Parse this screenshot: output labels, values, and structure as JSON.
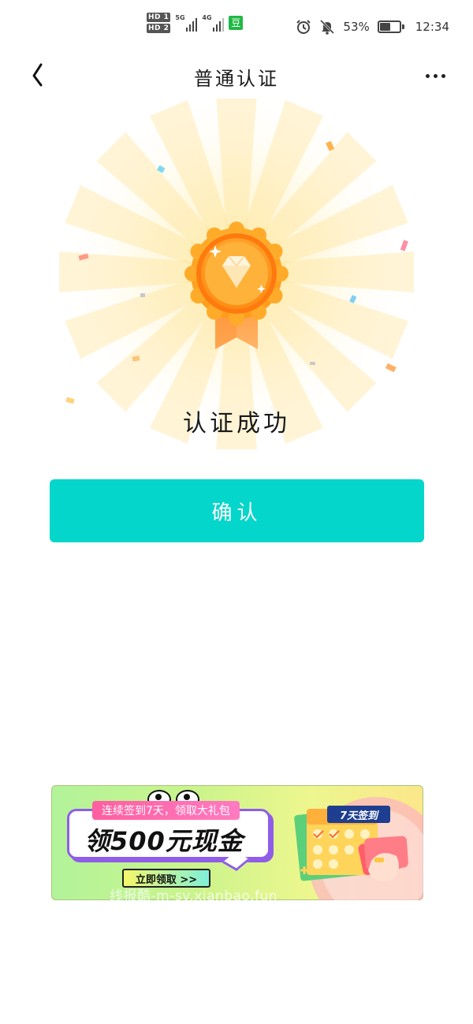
{
  "status_bar": {
    "hd_badges": [
      "HD 1",
      "HD 2"
    ],
    "network_1": "5G",
    "network_2": "4G",
    "app_badge": "豆",
    "battery_percent": "53%",
    "battery_level": 0.53,
    "time": "12:34",
    "icons": [
      "alarm-icon",
      "mute-icon",
      "battery-icon",
      "signal-icon"
    ]
  },
  "nav": {
    "title": "普通认证",
    "back_icon": "chevron-left-icon",
    "more_icon": "more-dots-icon"
  },
  "result": {
    "message": "认证成功",
    "icon": "medal-icon"
  },
  "actions": {
    "confirm_label": "确认"
  },
  "ad": {
    "subtitle": "连续签到7天，领取大礼包",
    "title": "领500元现金",
    "cta": "立即领取 >>",
    "badge": "7天签到",
    "watermark": "线报酷-m-sv.xianbao.fun"
  },
  "colors": {
    "primary": "#04d6cc",
    "medal_orange": "#ff9d1f",
    "medal_gold": "#ffc533",
    "ad_pink": "#ff5fa0",
    "ad_purple": "#8f5de8",
    "badge_green": "#20b845"
  }
}
